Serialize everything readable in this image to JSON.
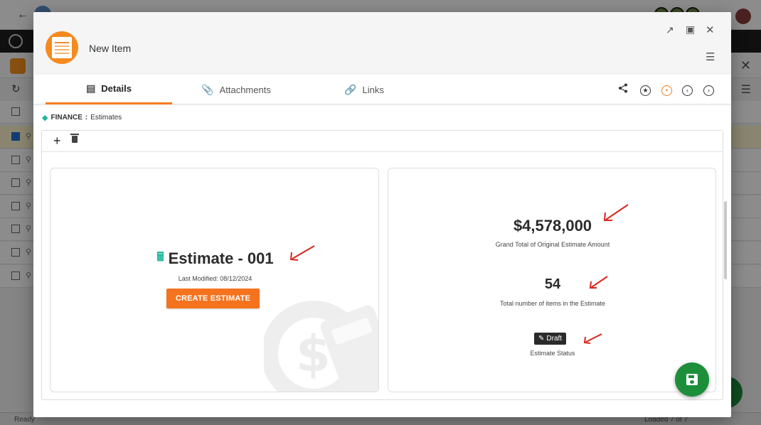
{
  "background": {
    "status_ready": "Ready",
    "status_loaded": "Loaded 7 of 7"
  },
  "modal": {
    "title": "New Item",
    "logo_name": "estimate-sheet-logo"
  },
  "tabs": [
    {
      "label": "Details",
      "icon": "details-icon",
      "active": true
    },
    {
      "label": "Attachments",
      "icon": "paperclip-icon",
      "active": false
    },
    {
      "label": "Links",
      "icon": "link-icon",
      "active": false
    }
  ],
  "breadcrumb": {
    "module": "FINANCE",
    "separator": ":",
    "page": "Estimates"
  },
  "estimate": {
    "title": "Estimate - 001",
    "last_modified": "Last Modified: 08/12/2024",
    "create_button": "CREATE ESTIMATE"
  },
  "stats": {
    "grand_total_value": "$4,578,000",
    "grand_total_label": "Grand Total of Original Estimate Amount",
    "item_count_value": "54",
    "item_count_label": "Total number of items in the Estimate",
    "status_value": "Draft",
    "status_label": "Estimate Status"
  },
  "colors": {
    "accent_orange": "#f5731e",
    "tab_underline": "#f57c1f",
    "teal": "#1fb89f",
    "save_green": "#1d8f3b",
    "arrow_red": "#d9261c"
  }
}
